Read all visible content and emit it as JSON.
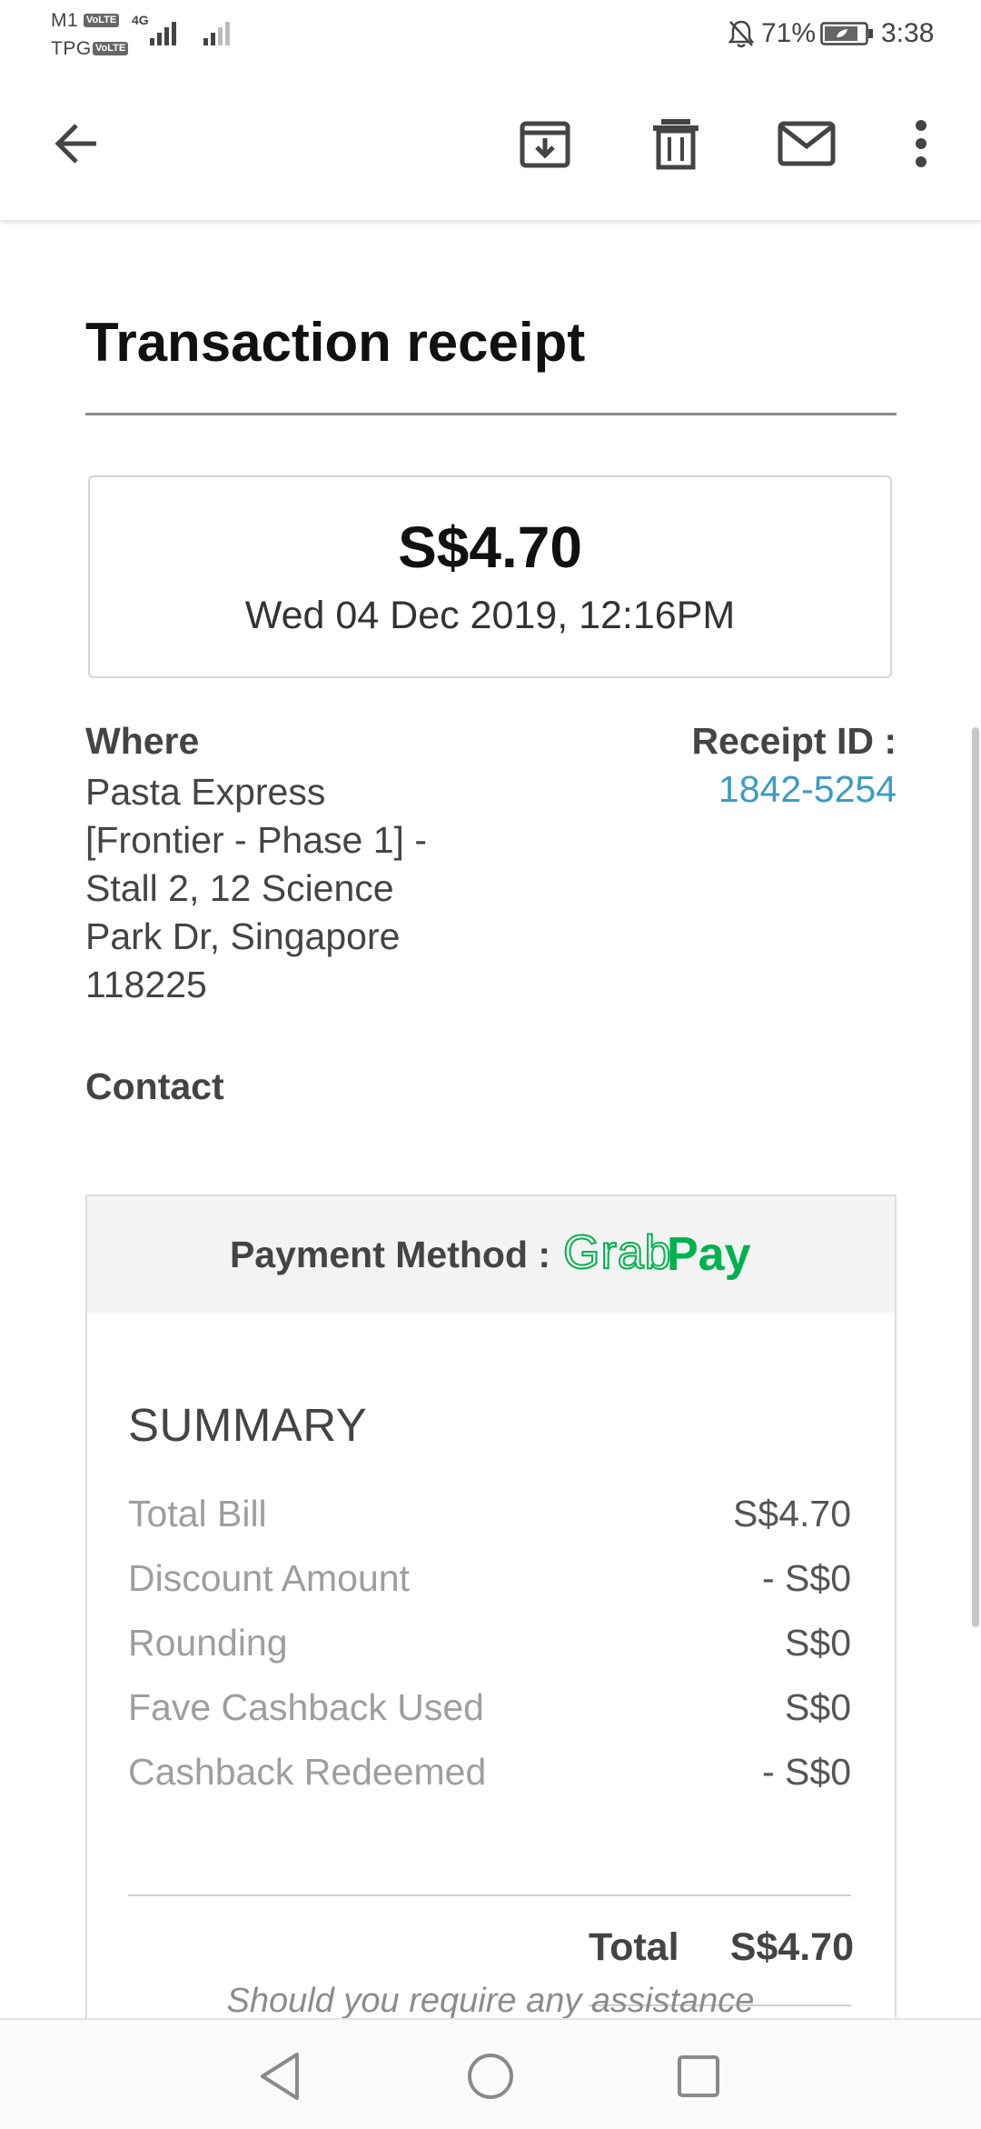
{
  "status_bar": {
    "carrier_1": "M1",
    "carrier_2": "TPG",
    "volte_badge": "VoLTE",
    "network_type": "4G",
    "battery_percent": "71%",
    "time": "3:38",
    "icons": [
      "signal-icon",
      "notifications-muted-icon",
      "battery-saver-icon"
    ]
  },
  "app_bar": {
    "icons": [
      "back-arrow-icon",
      "archive-icon",
      "trash-icon",
      "mail-icon",
      "more-vert-icon"
    ]
  },
  "receipt": {
    "title": "Transaction receipt",
    "amount": "S$4.70",
    "datetime": "Wed 04 Dec 2019, 12:16PM",
    "where_label": "Where",
    "where_address": "Pasta Express [Frontier - Phase 1] - Stall 2, 12 Science Park Dr, Singapore 118225",
    "receipt_id_label": "Receipt ID :",
    "receipt_id_value": "1842-5254",
    "contact_label": "Contact"
  },
  "payment": {
    "method_label": "Payment Method :",
    "method_logo_text": "GrabPay",
    "logo_color": "#00b14f"
  },
  "summary": {
    "heading": "SUMMARY",
    "rows": [
      {
        "label": "Total Bill",
        "value": "S$4.70"
      },
      {
        "label": "Discount Amount",
        "value": "- S$0"
      },
      {
        "label": "Rounding",
        "value": "S$0"
      },
      {
        "label": "Fave Cashback Used",
        "value": "S$0"
      },
      {
        "label": "Cashback Redeemed",
        "value": "- S$0"
      }
    ],
    "total_label": "Total",
    "total_value": "S$4.70",
    "assistance_note": "Should you require any assistance"
  },
  "nav_bar": {
    "icons": [
      "nav-back-icon",
      "nav-home-icon",
      "nav-recents-icon"
    ]
  },
  "colors": {
    "link": "#3a9cc4",
    "grabpay_green": "#00b14f"
  }
}
